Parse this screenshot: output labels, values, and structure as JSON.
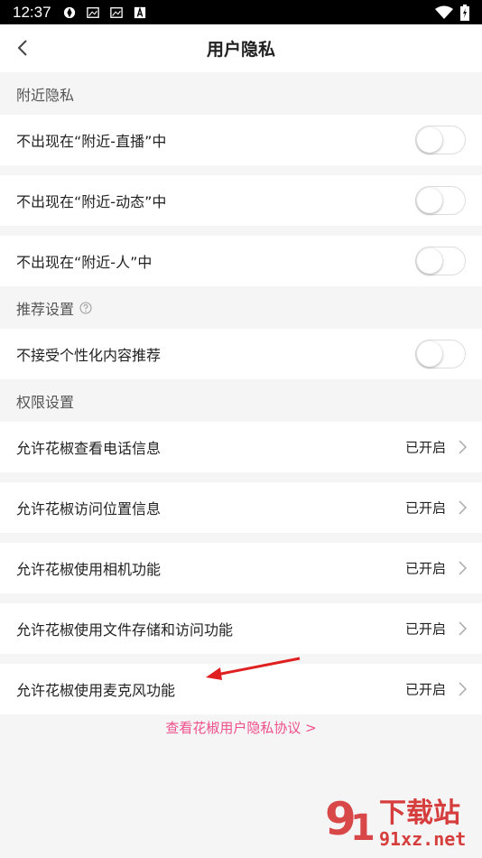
{
  "status_bar": {
    "time": "12:37"
  },
  "header": {
    "title": "用户隐私"
  },
  "sections": {
    "nearby": {
      "title": "附近隐私",
      "items": [
        {
          "label": "不出现在“附近-直播”中",
          "enabled": false
        },
        {
          "label": "不出现在“附近-动态”中",
          "enabled": false
        },
        {
          "label": "不出现在“附近-人”中",
          "enabled": false
        }
      ]
    },
    "recommend": {
      "title": "推荐设置",
      "items": [
        {
          "label": "不接受个性化内容推荐",
          "enabled": false
        }
      ]
    },
    "permissions": {
      "title": "权限设置",
      "items": [
        {
          "label": "允许花椒查看电话信息",
          "status": "已开启"
        },
        {
          "label": "允许花椒访问位置信息",
          "status": "已开启"
        },
        {
          "label": "允许花椒使用相机功能",
          "status": "已开启"
        },
        {
          "label": "允许花椒使用文件存储和访问功能",
          "status": "已开启"
        },
        {
          "label": "允许花椒使用麦克风功能",
          "status": "已开启"
        }
      ]
    }
  },
  "footer": {
    "policy_link": "查看花椒用户隐私协议 >"
  },
  "watermark": {
    "brand": "下载站",
    "domain": "91xz.net"
  },
  "colors": {
    "link": "#ef4f8b",
    "arrow": "#e02020",
    "watermark": "#d32a2a"
  }
}
